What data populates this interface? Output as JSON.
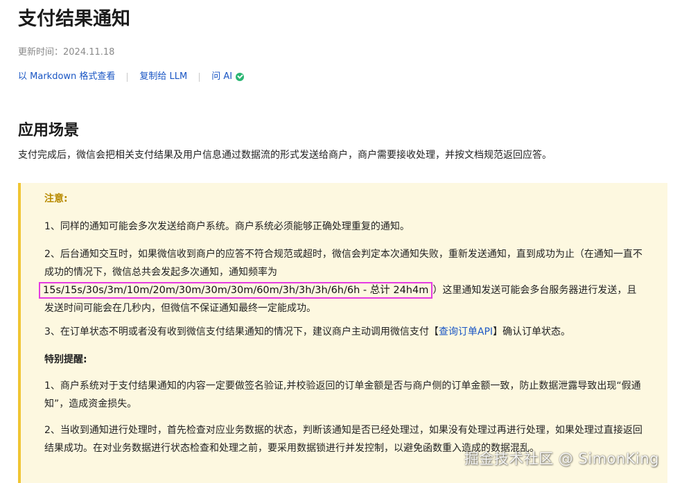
{
  "doc": {
    "title": "支付结果通知",
    "updated": "更新时间：2024.11.18",
    "links": {
      "markdown": "以 Markdown 格式查看",
      "copy_llm": "复制给 LLM",
      "ask_ai": "问 AI"
    }
  },
  "section": {
    "heading": "应用场景",
    "intro": "支付完成后，微信会把相关支付结果及用户信息通过数据流的形式发送给商户，商户需要接收处理，并按文档规范返回应答。"
  },
  "notice": {
    "label": "注意:",
    "item1": "1、同样的通知可能会多次发送给商户系统。商户系统必须能够正确处理重复的通知。",
    "item2_before": "2、后台通知交互时，如果微信收到商户的应答不符合规范或超时，微信会判定本次通知失败，重新发送通知，直到成功为止（在通知一直不成功的情况下，微信总共会发起多次通知，通知频率为",
    "item2_freq": "15s/15s/30s/3m/10m/20m/30m/30m/30m/60m/3h/3h/3h/6h/6h - 总计 24h4m",
    "item2_after": "）这里通知发送可能会多台服务器进行发送，且发送时间可能会在几秒内，但微信不保证通知最终一定能成功。",
    "item3_before": "3、在订单状态不明或者没有收到微信支付结果通知的情况下，建议商户主动调用微信支付【",
    "item3_link": "查询订单API",
    "item3_after": "】确认订单状态。",
    "special_label": "特别提醒:",
    "special1": "1、商户系统对于支付结果通知的内容一定要做签名验证,并校验返回的订单金额是否与商户侧的订单金额一致，防止数据泄露导致出现“假通知”，造成资金损失。",
    "special2": "2、当收到通知进行处理时，首先检查对应业务数据的状态，判断该通知是否已经处理过，如果没有处理过再进行处理，如果处理过直接返回结果成功。在对业务数据进行状态检查和处理之前，要采用数据锁进行并发控制，以避免函数重入造成的数据混乱。"
  },
  "watermark": "掘金技术社区 @ SimonKing",
  "colors": {
    "link": "#1a56c4",
    "notice_bg": "#fdf8e0",
    "notice_border": "#f0c533",
    "notice_label": "#b88a00",
    "highlight_box": "#e53be3",
    "ai_icon": "#2bb673"
  }
}
